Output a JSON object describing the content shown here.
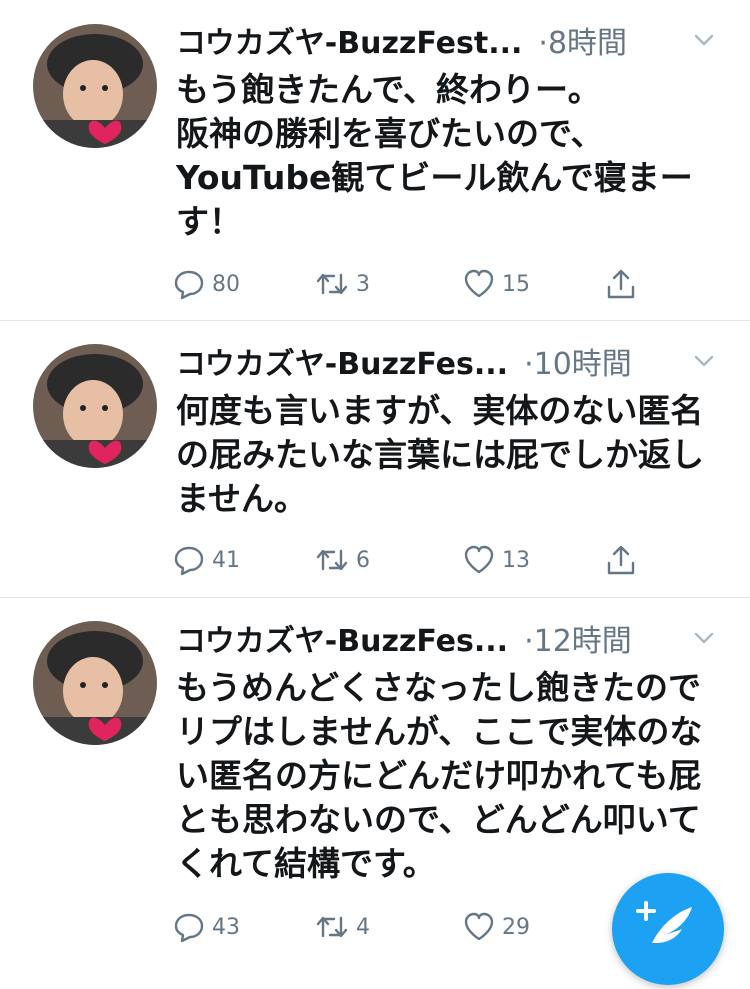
{
  "tweets": [
    {
      "name": "コウカズヤ-BuzzFest...",
      "time": "·8時間",
      "lines": [
        "もう飽きたんで、終わりー。",
        "阪神の勝利を喜びたいので、",
        "YouTube観てビール飲んで寝まー",
        "す！"
      ],
      "replies": "80",
      "retweets": "3",
      "likes": "15"
    },
    {
      "name": "コウカズヤ-BuzzFes...",
      "time": "·10時間",
      "lines": [
        "何度も言いますが、実体のない匿名",
        "の屁みたいな言葉には屁でしか返し",
        "ません。"
      ],
      "replies": "41",
      "retweets": "6",
      "likes": "13"
    },
    {
      "name": "コウカズヤ-BuzzFes...",
      "time": "·12時間",
      "lines": [
        "もうめんどくさなったし飽きたので",
        "リプはしませんが、ここで実体のな",
        "い匿名の方にどんだけ叩かれても屁",
        "とも思わないので、どんどん叩いて",
        "くれて結構です。"
      ],
      "replies": "43",
      "retweets": "4",
      "likes": "29"
    }
  ],
  "colors": {
    "accent": "#1da1f2",
    "muted": "#657786",
    "heart": "#e0245e"
  },
  "icons": [
    "reply-icon",
    "retweet-icon",
    "like-icon",
    "share-icon",
    "chevron-down-icon",
    "compose-tweet-icon"
  ]
}
